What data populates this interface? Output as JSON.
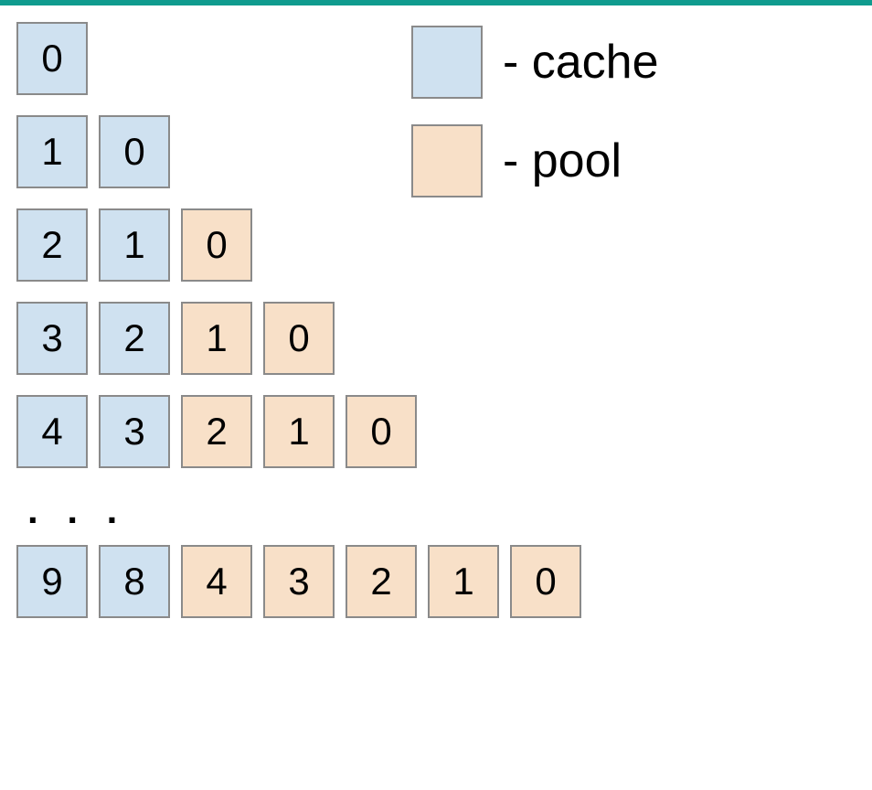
{
  "colors": {
    "cache": "#cfe1f0",
    "pool": "#f8e0c8",
    "border": "#8a8a8a",
    "topbar": "#0f9b8e"
  },
  "legend": {
    "cache_label": "- cache",
    "pool_label": "- pool"
  },
  "ellipsis": ". . .",
  "rows": [
    {
      "cells": [
        {
          "v": "0",
          "type": "cache"
        }
      ]
    },
    {
      "cells": [
        {
          "v": "1",
          "type": "cache"
        },
        {
          "v": "0",
          "type": "cache"
        }
      ]
    },
    {
      "cells": [
        {
          "v": "2",
          "type": "cache"
        },
        {
          "v": "1",
          "type": "cache"
        },
        {
          "v": "0",
          "type": "pool"
        }
      ]
    },
    {
      "cells": [
        {
          "v": "3",
          "type": "cache"
        },
        {
          "v": "2",
          "type": "cache"
        },
        {
          "v": "1",
          "type": "pool"
        },
        {
          "v": "0",
          "type": "pool"
        }
      ]
    },
    {
      "cells": [
        {
          "v": "4",
          "type": "cache"
        },
        {
          "v": "3",
          "type": "cache"
        },
        {
          "v": "2",
          "type": "pool"
        },
        {
          "v": "1",
          "type": "pool"
        },
        {
          "v": "0",
          "type": "pool"
        }
      ]
    },
    {
      "cells": [
        {
          "v": "9",
          "type": "cache"
        },
        {
          "v": "8",
          "type": "cache"
        },
        {
          "v": "4",
          "type": "pool"
        },
        {
          "v": "3",
          "type": "pool"
        },
        {
          "v": "2",
          "type": "pool"
        },
        {
          "v": "1",
          "type": "pool"
        },
        {
          "v": "0",
          "type": "pool"
        }
      ]
    }
  ]
}
